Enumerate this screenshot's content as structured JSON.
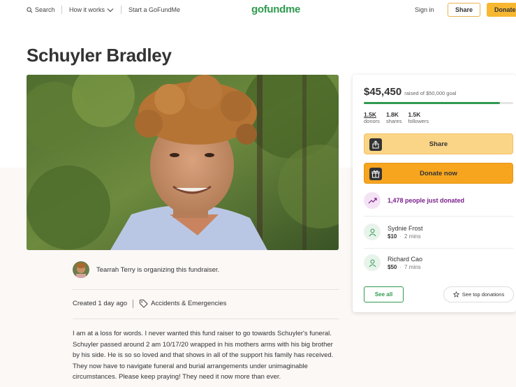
{
  "nav": {
    "search_label": "Search",
    "how_it_works_label": "How it works",
    "start_label": "Start a GoFundMe",
    "logo_text": "gofundme",
    "sign_in_label": "Sign in",
    "share_label": "Share",
    "donate_label": "Donate"
  },
  "campaign": {
    "title": "Schuyler Bradley",
    "organizer_text": "Tearrah Terry is organizing this fundraiser.",
    "created": "Created 1 day ago",
    "category": "Accidents & Emergencies",
    "story": "I am at a loss for words. I never wanted this fund raiser to go towards Schuyler's funeral. Schuyler passed around 2 am 10/17/20 wrapped in his mothers arms with his big brother by his side. He is so so loved and that shows in all of the support his family has received. They now have to navigate funeral and burial arrangements under unimaginable circumstances. Please keep praying! They need it now more than ever."
  },
  "card": {
    "raised": "$45,450",
    "goal_text": "raised of $50,000 goal",
    "progress_fraction": 0.909,
    "donors_count": "1.5K",
    "donors_label": "donors",
    "shares_count": "1.8K",
    "shares_label": "shares",
    "followers_count": "1.5K",
    "followers_label": "followers",
    "share_button": "Share",
    "donate_button": "Donate now",
    "recent_text": "1,478 people just donated",
    "donations": [
      {
        "name": "Sydnie Frost",
        "amount": "$10",
        "time": "2 mins"
      },
      {
        "name": "Richard Cao",
        "amount": "$50",
        "time": "7 mins"
      }
    ],
    "see_all": "See all",
    "see_top": "See top donations"
  },
  "colors": {
    "brand_green": "#2f9a4f",
    "donate_orange": "#f7a51f",
    "share_yellow": "#fbd587",
    "recent_purple": "#7a1d8c"
  }
}
